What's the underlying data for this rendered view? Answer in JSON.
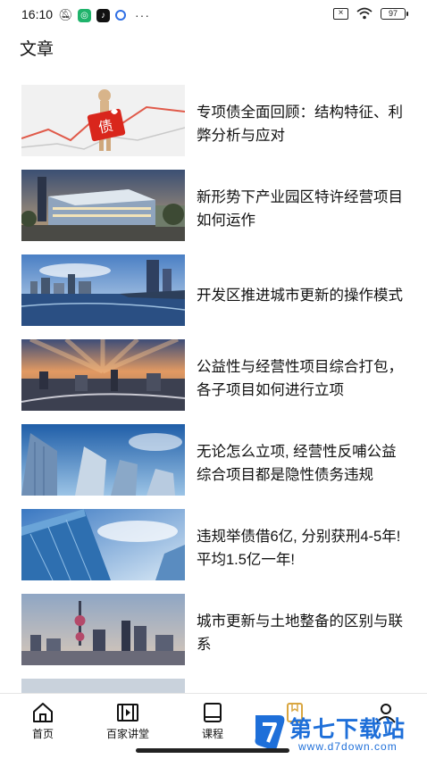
{
  "status_bar": {
    "time": "16:10",
    "battery": "97",
    "more": "···"
  },
  "page": {
    "title": "文章"
  },
  "articles": [
    {
      "title": "专项债全面回顾：结构特征、利弊分析与应对",
      "image": "bond-figure-image"
    },
    {
      "title": "新形势下产业园区特许经营项目如何运作",
      "image": "industrial-park-image"
    },
    {
      "title": "开发区推进城市更新的操作模式",
      "image": "waterfront-skyline-image"
    },
    {
      "title": "公益性与经营性项目综合打包，各子项目如何进行立项",
      "image": "sunset-city-image"
    },
    {
      "title": "无论怎么立项, 经营性反哺公益综合项目都是隐性债务违规",
      "image": "skyscrapers-image"
    },
    {
      "title": "违规举债借6亿, 分别获刑4-5年! 平均1.5亿一年!",
      "image": "glass-tower-image"
    },
    {
      "title": "城市更新与土地整备的区别与联系",
      "image": "tower-skyline-image"
    }
  ],
  "nav": {
    "home": "首页",
    "lecture": "百家讲堂",
    "course": "课程"
  },
  "watermark": {
    "name": "第七下载站",
    "url": "www.d7down.com"
  },
  "colors": {
    "accent": "#1e6fd9",
    "bond_red": "#d9261c"
  }
}
